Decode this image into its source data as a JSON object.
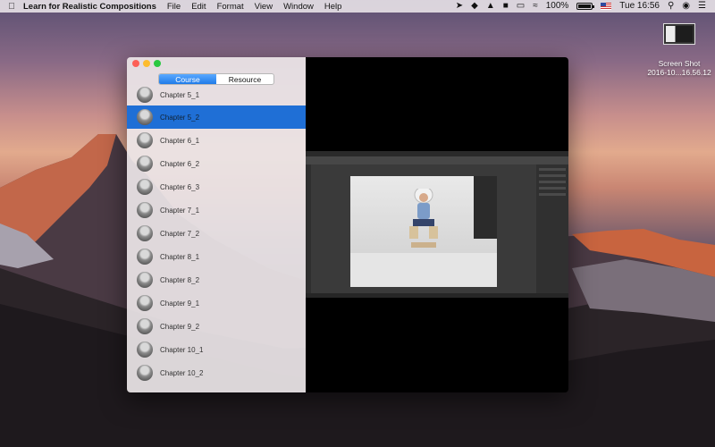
{
  "menubar": {
    "app_name": "Learn for Realistic Compositions",
    "menus": [
      "File",
      "Edit",
      "Format",
      "View",
      "Window",
      "Help"
    ],
    "battery_percent": "100%",
    "clock": "Tue 16:56",
    "icons": [
      "apple-logo-icon",
      "location-arrow-icon",
      "app-status-icon",
      "hat-icon",
      "lock-icon",
      "drive-icon",
      "wifi-icon",
      "battery-icon",
      "us-flag-icon",
      "spotlight-icon",
      "siri-icon",
      "notification-center-icon"
    ]
  },
  "desktop": {
    "file_label_line1": "Screen Shot",
    "file_label_line2": "2016-10...16.56.12"
  },
  "window": {
    "tabs": [
      {
        "label": "Course",
        "active": true
      },
      {
        "label": "Resource",
        "active": false
      }
    ],
    "chapters": [
      "Chapter 5_1",
      "Chapter 5_2",
      "Chapter 6_1",
      "Chapter 6_2",
      "Chapter 6_3",
      "Chapter 7_1",
      "Chapter 7_2",
      "Chapter 8_1",
      "Chapter 8_2",
      "Chapter 9_1",
      "Chapter 9_2",
      "Chapter 10_1",
      "Chapter 10_2"
    ],
    "selected_chapter": "Chapter 5_2"
  },
  "colors": {
    "selection": "#1f6fd6",
    "segment_active": "#2a85ee",
    "traffic_red": "#fc5f57",
    "traffic_yellow": "#fdbc2e",
    "traffic_green": "#29c841"
  }
}
